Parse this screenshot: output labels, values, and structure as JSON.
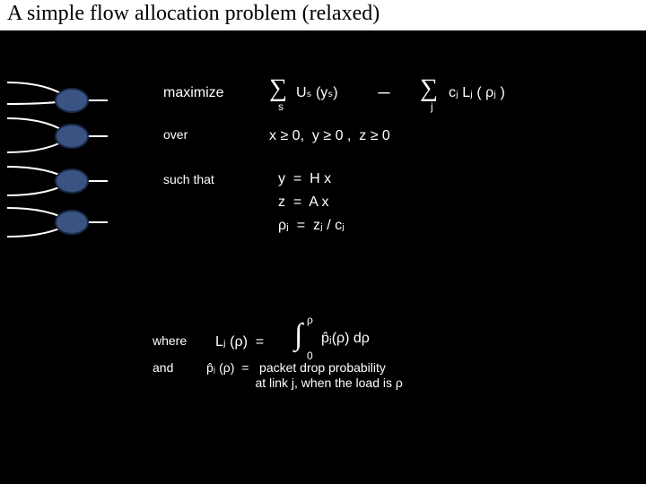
{
  "title": "A simple flow allocation problem (relaxed)",
  "labels": {
    "maximize": "maximize",
    "over": "over",
    "such_that": "such that",
    "where": "where",
    "and": "and"
  },
  "expr": {
    "objective_sum1_sub": "s",
    "objective_term1": "Uₛ (yₛ)",
    "objective_minus": "−",
    "objective_sum2_sub": "j",
    "objective_term2": "cⱼ Lⱼ ( ρⱼ )",
    "over_constraints": "x ≥ 0,  y ≥ 0 ,  z ≥ 0",
    "st1": "y  =  H x",
    "st2": "z  =  A x",
    "st3": "ρⱼ  =  zⱼ / cⱼ",
    "Ldef_lhs": "Lⱼ (ρ)  =",
    "Ldef_int_lb": "0",
    "Ldef_int_ub": "ρ",
    "Ldef_integrand": "p̂ⱼ(ρ) dρ",
    "pdef": "p̂ⱼ (ρ)  =   packet drop probability\n              at link j, when the load is ρ"
  }
}
